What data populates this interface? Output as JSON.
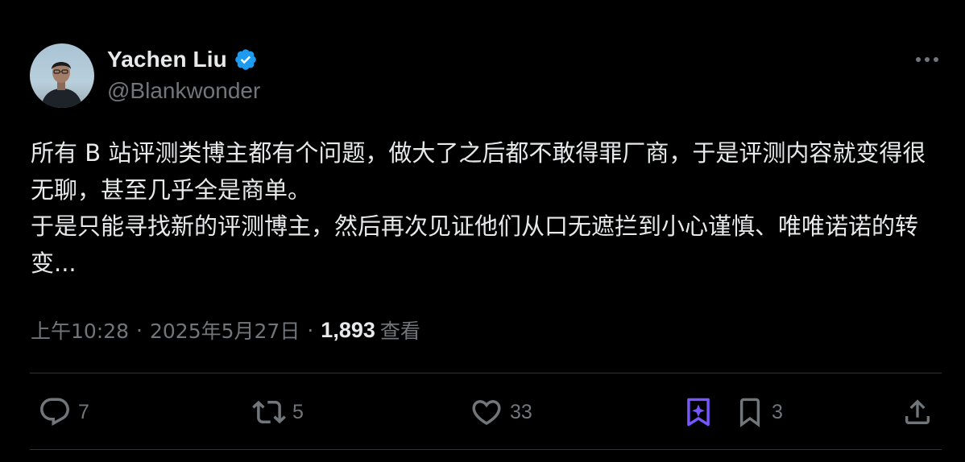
{
  "author": {
    "display_name": "Yachen Liu",
    "handle": "@Blankwonder",
    "verified": true
  },
  "tweet": {
    "paragraphs": [
      "所有 B 站评测类博主都有个问题，做大了之后都不敢得罪厂商，于是评测内容就变得很无聊，甚至几乎全是商单。",
      "于是只能寻找新的评测博主，然后再次见证他们从口无遮拦到小心谨慎、唯唯诺诺的转变..."
    ]
  },
  "meta": {
    "time": "上午10:28",
    "separator": "·",
    "date": "2025年5月27日",
    "views_count": "1,893",
    "views_label": "查看"
  },
  "actions": {
    "reply_count": "7",
    "repost_count": "5",
    "like_count": "33",
    "bookmark_count": "3"
  },
  "icons": {
    "verified": "verified-badge-icon",
    "more": "more-icon",
    "reply": "reply-icon",
    "repost": "repost-icon",
    "like": "heart-icon",
    "grok": "grok-icon",
    "bookmark": "bookmark-icon",
    "share": "share-icon"
  },
  "colors": {
    "background": "#000000",
    "text_primary": "#e7e9ea",
    "text_secondary": "#71767b",
    "verified_blue": "#1d9bf0",
    "accent_purple": "#7856ff",
    "divider": "#2f3336"
  }
}
